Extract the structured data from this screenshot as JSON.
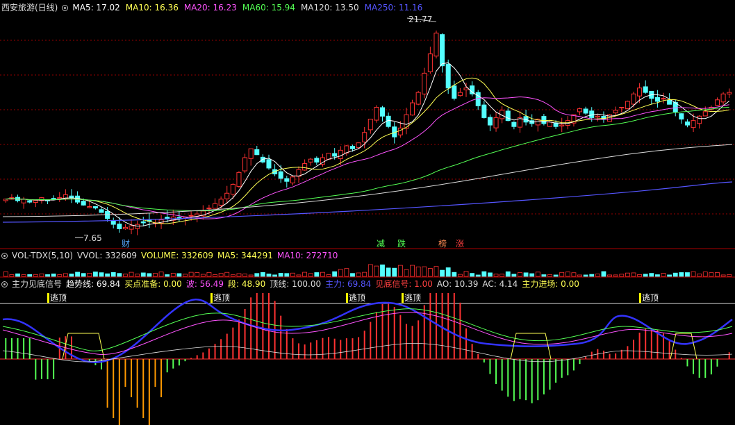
{
  "main_panel": {
    "title": "西安旅游(日线)",
    "indicators": [
      {
        "label": "MA5: 17.02",
        "color": "#ffffff"
      },
      {
        "label": "MA10: 16.36",
        "color": "#ffff54"
      },
      {
        "label": "MA20: 16.23",
        "color": "#ff54ff"
      },
      {
        "label": "MA60: 15.94",
        "color": "#54ff54"
      },
      {
        "label": "MA120: 13.50",
        "color": "#dddddd"
      },
      {
        "label": "MA250: 11.16",
        "color": "#5555ff"
      }
    ],
    "high_label": "21.77",
    "low_label": "7.65",
    "markers": [
      {
        "text": "财",
        "color": "#54a8ff"
      },
      {
        "text": "减",
        "color": "#54ff54"
      },
      {
        "text": "跌",
        "color": "#54ff54"
      },
      {
        "text": "榜",
        "color": "#ff8c54"
      },
      {
        "text": "涨",
        "color": "#ff4040"
      }
    ]
  },
  "volume_panel": {
    "indicators": [
      {
        "label": "VOL-TDX(5,10)",
        "color": "#dddddd"
      },
      {
        "label": "VVOL: 332609",
        "color": "#dddddd"
      },
      {
        "label": "VOLUME: 332609",
        "color": "#ffff54"
      },
      {
        "label": "MA5: 344291",
        "color": "#ffff54"
      },
      {
        "label": "MA10: 272710",
        "color": "#ff54ff"
      }
    ]
  },
  "osc_panel": {
    "indicators": [
      {
        "label": "主力见底信号",
        "color": "#dddddd"
      },
      {
        "label": "趋势线: 69.84",
        "color": "#ffffff"
      },
      {
        "label": "买点准备: 0.00",
        "color": "#ffff54"
      },
      {
        "label": "波: 56.49",
        "color": "#ff54ff"
      },
      {
        "label": "段: 48.90",
        "color": "#ffff54"
      },
      {
        "label": "顶线: 100.00",
        "color": "#dddddd"
      },
      {
        "label": "主力: 69.84",
        "color": "#5555ff"
      },
      {
        "label": "见底信号: 1.00",
        "color": "#ff4040"
      },
      {
        "label": "AO: 10.39",
        "color": "#dddddd"
      },
      {
        "label": "AC: 4.14",
        "color": "#dddddd"
      },
      {
        "label": "主力进场: 0.00",
        "color": "#ffff54"
      }
    ],
    "top_signals": [
      "逃顶",
      "逃顶",
      "逃顶",
      "逃顶",
      "逃顶"
    ]
  },
  "colors": {
    "up": "#ff3232",
    "down": "#54ffff",
    "grid": "#990000"
  },
  "chart_data": {
    "type": "candlestick",
    "x": "trading days (unlabeled)",
    "close": [
      9.8,
      9.9,
      9.7,
      9.8,
      9.6,
      9.7,
      9.9,
      9.7,
      9.8,
      9.9,
      10.1,
      9.9,
      9.6,
      9.4,
      9.3,
      9.2,
      8.9,
      8.5,
      8.1,
      7.8,
      7.9,
      8.0,
      8.1,
      8.2,
      8.3,
      8.2,
      8.4,
      8.5,
      8.6,
      8.5,
      8.6,
      8.7,
      8.8,
      9.0,
      9.2,
      9.5,
      9.8,
      10.2,
      10.8,
      11.6,
      12.6,
      13.2,
      12.8,
      12.3,
      11.9,
      11.5,
      11.2,
      11.0,
      11.3,
      11.8,
      12.2,
      12.5,
      12.3,
      12.6,
      12.9,
      12.7,
      13.1,
      13.4,
      13.2,
      13.6,
      14.3,
      15.2,
      16.0,
      15.4,
      14.7,
      14.0,
      14.6,
      15.5,
      16.3,
      17.0,
      18.3,
      19.6,
      21.0,
      18.8,
      17.3,
      16.6,
      17.0,
      17.3,
      16.9,
      16.1,
      15.3,
      14.8,
      15.3,
      15.8,
      15.1,
      14.7,
      15.3,
      15.0,
      14.9,
      15.2,
      14.9,
      15.0,
      14.7,
      14.8,
      15.1,
      15.5,
      15.9,
      15.6,
      15.3,
      15.4,
      15.2,
      15.5,
      15.8,
      16.0,
      16.4,
      16.9,
      17.3,
      17.0,
      16.6,
      16.4,
      16.6,
      16.2,
      15.7,
      15.2,
      14.8,
      15.1,
      15.4,
      15.7,
      16.0,
      16.5,
      16.9,
      17.0
    ],
    "high_value": 21.77,
    "low_value": 7.65
  }
}
